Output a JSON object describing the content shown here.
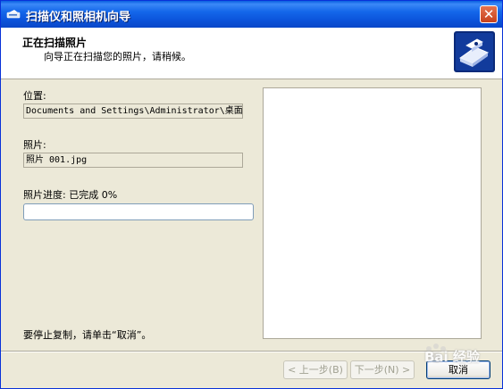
{
  "window": {
    "title": "扫描仪和照相机向导",
    "close_glyph": "✕"
  },
  "header": {
    "title": "正在扫描照片",
    "subtitle": "向导正在扫描您的照片，请稍候。",
    "logo_icon": "scanner-camera-icon"
  },
  "location": {
    "label": "位置:",
    "value": "Documents and Settings\\Administrator\\桌面"
  },
  "photo": {
    "label": "照片:",
    "value": "照片 001.jpg"
  },
  "progress": {
    "label": "照片进度: 已完成 0%",
    "percent": 0,
    "fill_color": "#32c131"
  },
  "footer_note": "要停止复制，请单击“取消”。",
  "buttons": {
    "back": "< 上一步(B)",
    "next": "下一步(N) >",
    "cancel": "取消"
  },
  "watermark": {
    "text": "Bai 经验"
  },
  "colors": {
    "titlebar": "#0c55dc",
    "dialog_bg": "#ece9d8",
    "close_button": "#d9532c"
  }
}
